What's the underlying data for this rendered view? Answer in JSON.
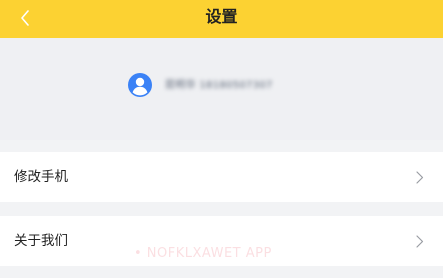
{
  "header": {
    "title": "设置",
    "back_icon": "chevron-left-icon",
    "background_color": "#fcd232"
  },
  "profile": {
    "avatar_icon": "user-avatar-icon",
    "avatar_color": "#3b82f6",
    "text": "昆明华 18180507307"
  },
  "settings": [
    {
      "label": "修改手机",
      "icon": "chevron-right-icon"
    },
    {
      "label": "关于我们",
      "icon": "chevron-right-icon"
    }
  ],
  "watermark": "• NOFKLXAWET APP"
}
